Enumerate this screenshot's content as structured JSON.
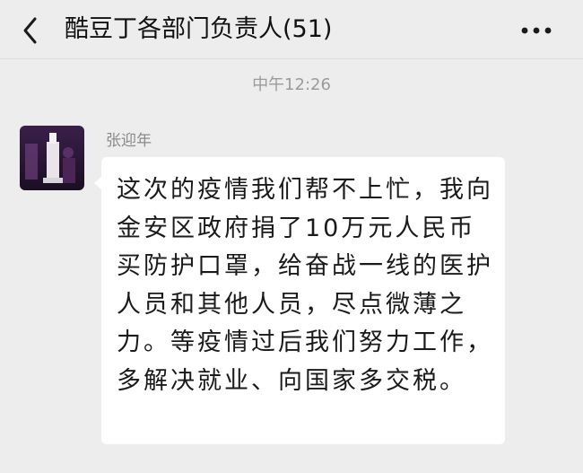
{
  "header": {
    "title": "酷豆丁各部门负责人(51)",
    "back_icon": "chevron-left-icon",
    "more_icon": "more-dots-icon"
  },
  "chat": {
    "timestamp": "中午12:26",
    "messages": [
      {
        "sender": "张迎年",
        "avatar": "user-avatar",
        "text": "这次的疫情我们帮不上忙，我向金安区政府捐了10万元人民币买防护口罩，给奋战一线的医护人员和其他人员，尽点微薄之力。等疫情过后我们努力工作，多解决就业、向国家多交税。"
      }
    ]
  },
  "colors": {
    "background": "#ededed",
    "bubble": "#ffffff",
    "timestamp": "#9b9b9b"
  }
}
